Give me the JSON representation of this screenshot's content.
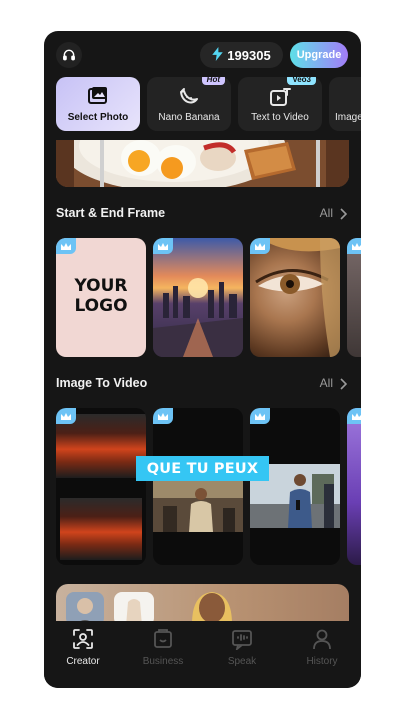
{
  "header": {
    "credits_value": "199305",
    "upgrade_label": "Upgrade"
  },
  "tools": [
    {
      "label": "Select Photo",
      "icon": "photo-icon",
      "badge": ""
    },
    {
      "label": "Nano Banana",
      "icon": "banana-icon",
      "badge": "Hot"
    },
    {
      "label": "Text to Video",
      "icon": "text-to-video-icon",
      "badge": "Veo3"
    },
    {
      "label": "Image",
      "icon": "image-icon",
      "badge": ""
    }
  ],
  "sections": {
    "start_end": {
      "title": "Start & End Frame",
      "all_label": "All"
    },
    "image_to_video": {
      "title": "Image To Video",
      "all_label": "All"
    }
  },
  "cards": {
    "logo_text_line1": "YOUR",
    "logo_text_line2": "LOGO",
    "caption": "QUE TU PEUX"
  },
  "nav": [
    {
      "label": "Creator",
      "icon": "creator-icon",
      "active": true
    },
    {
      "label": "Business",
      "icon": "business-icon",
      "active": false
    },
    {
      "label": "Speak",
      "icon": "speak-icon",
      "active": false
    },
    {
      "label": "History",
      "icon": "history-icon",
      "active": false
    }
  ],
  "colors": {
    "background": "#161616",
    "accent_crown": "#6dc3f5",
    "upgrade_gradient_start": "#5ee0e8",
    "upgrade_gradient_end": "#a37cf7",
    "caption_bg": "#35c6f4"
  }
}
